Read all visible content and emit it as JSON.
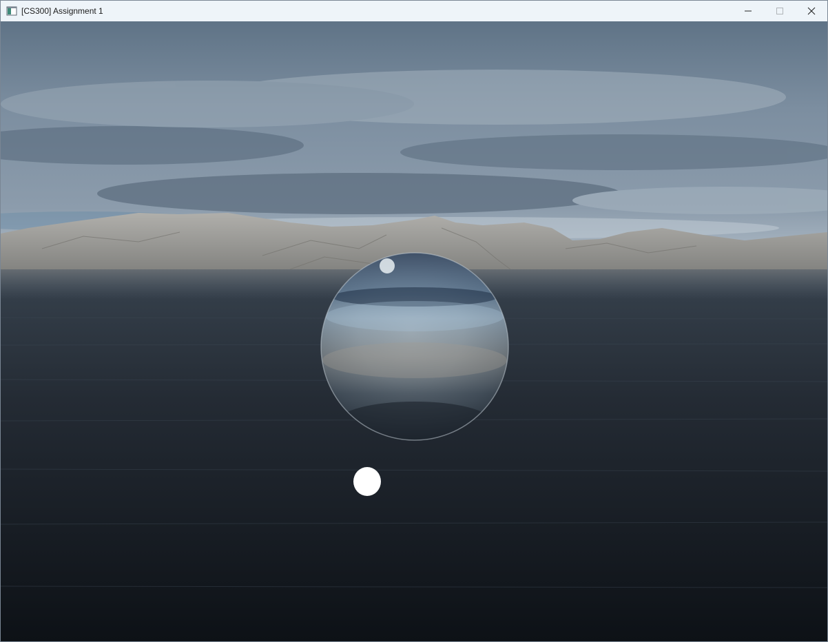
{
  "window": {
    "title": "[CS300] Assignment 1",
    "icon": "app-window-icon"
  },
  "controls": {
    "minimize_icon": "minimize-icon",
    "maximize_icon": "maximize-icon",
    "close_icon": "close-icon"
  },
  "scene": {
    "objects": [
      "skybox",
      "mountains",
      "water",
      "reflective-sphere",
      "light-source"
    ],
    "colors": {
      "sky_top": "#6c7f94",
      "sky_mid": "#8193a6",
      "sky_horizon": "#b6c2cd",
      "mountain": "#9d9d9a",
      "water_near": "#10151b",
      "water_far": "#3b4754",
      "light": "#ffffff"
    }
  }
}
